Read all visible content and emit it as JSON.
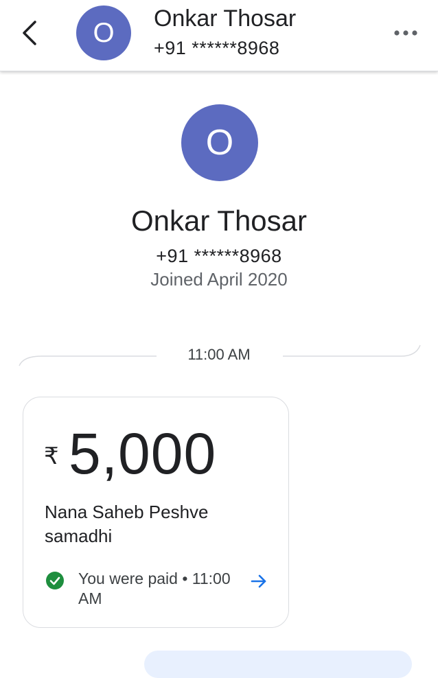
{
  "header": {
    "avatar_initial": "O",
    "name": "Onkar Thosar",
    "phone": "+91 ******8968"
  },
  "profile": {
    "avatar_initial": "O",
    "name": "Onkar Thosar",
    "phone": "+91 ******8968",
    "joined": "Joined April 2020"
  },
  "timeline": {
    "time": "11:00 AM"
  },
  "payment": {
    "currency_symbol": "₹",
    "amount": "5,000",
    "note": "Nana Saheb Peshve samadhi",
    "status": "You were paid • 11:00 AM"
  },
  "icons": {
    "back": "chevron-left-icon",
    "more": "more-horizontal-icon",
    "status": "check-circle-icon",
    "open": "arrow-right-icon"
  },
  "colors": {
    "avatar": "#5c6bc0",
    "success": "#1e8e3e",
    "link": "#1a73e8",
    "text": "#202124",
    "secondary_text": "#5f6368"
  }
}
